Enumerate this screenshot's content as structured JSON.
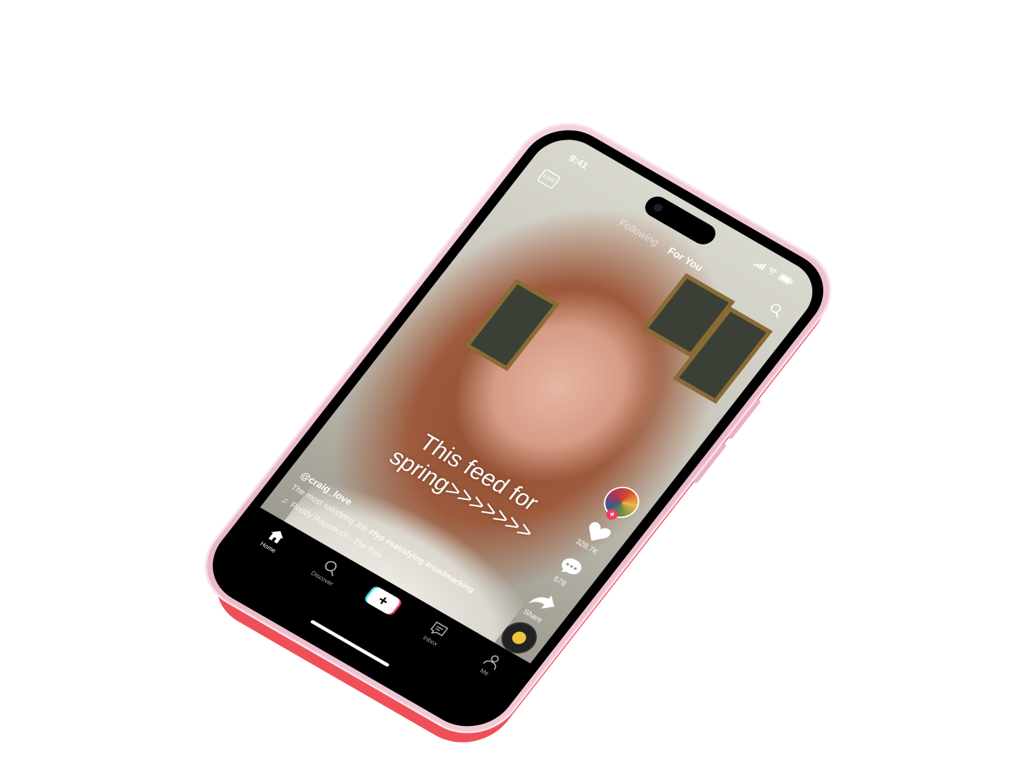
{
  "status": {
    "time": "9:41"
  },
  "header": {
    "live_label": "LIVE",
    "tabs": [
      {
        "label": "Following"
      },
      {
        "label": "For You"
      }
    ]
  },
  "video": {
    "overlay_text": "This feed for spring>>>>>>>"
  },
  "actions": {
    "likes": "328.7K",
    "comments": "578",
    "share_label": "Share"
  },
  "post": {
    "username": "@craig_love",
    "description": "The most satisfying Job",
    "hashtags": [
      "#fyp",
      "#satisfying",
      "#roadmarking"
    ],
    "music": "Roddy Roundicch - The Rou"
  },
  "nav": {
    "items": [
      {
        "label": "Home"
      },
      {
        "label": "Discover"
      },
      {
        "label": ""
      },
      {
        "label": "Inbox"
      },
      {
        "label": "Me"
      }
    ]
  },
  "colors": {
    "accent_red": "#ef3e5c",
    "accent_cyan": "#3ee0e8",
    "case_red": "#ef5058",
    "phone_pink": "#f3cbd8"
  }
}
